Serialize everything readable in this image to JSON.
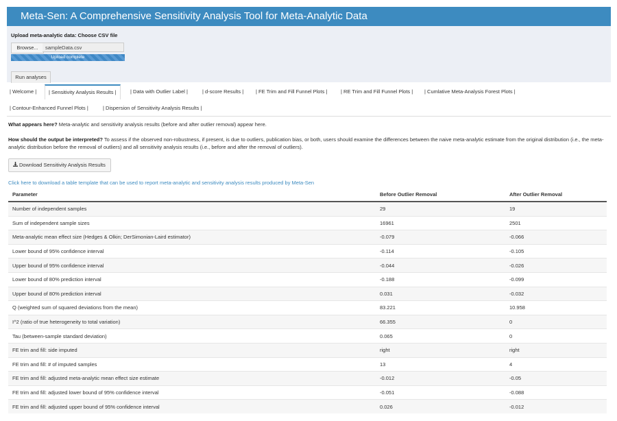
{
  "app": {
    "title": "Meta-Sen: A Comprehensive Sensitivity Analysis Tool for Meta-Analytic Data"
  },
  "upload": {
    "label": "Upload meta-analytic data: Choose CSV file",
    "browse_label": "Browse...",
    "file_name": "sampleData.csv",
    "progress_text": "Upload complete",
    "progress_percent": 100
  },
  "run_button": "Run analyses",
  "tabs": [
    "| Welcome |",
    "| Sensitivity Analysis Results |",
    "| Data with Outlier Label |",
    "| d-score Results |",
    "| FE Trim and Fill Funnel Plots |",
    "| RE Trim and Fill Funnel Plots |",
    "| Cumlative Meta-Analysis Forest Plots |",
    "| Contour-Enhanced Funnel Plots |",
    "| Dispersion of Sensitivity Analysis Results |"
  ],
  "active_tab": 1,
  "info": {
    "q1": "What appears here?",
    "a1": "Meta-analytic and sensitivity analysis results (before and after outlier removal) appear here.",
    "q2": "How should the output be interpreted?",
    "a2": "To assess if the observed non-robustness, if present, is due to outliers, publication bias, or both, users should examine the differences between the naive meta-analytic estimate from the original distribution (i.e., the meta-analytic distribution before the removal of outliers) and all sensitivity analysis results (i.e., before and after the removal of outliers)."
  },
  "download_button": "Download Sensitivity Analysis Results",
  "template_link": "Click here to download a table template that can be used to report meta-analytic and sensitivity analysis results produced by Meta-Sen",
  "table": {
    "headers": [
      "Parameter",
      "Before Outlier Removal",
      "After Outlier Removal"
    ],
    "rows": [
      [
        "Number of independent samples",
        "29",
        "19"
      ],
      [
        "Sum of independent sample sizes",
        "16961",
        "2501"
      ],
      [
        "Meta-analytic mean effect size (Hedges & Olkin; DerSimonian-Laird estimator)",
        "-0.079",
        "-0.066"
      ],
      [
        "Lower bound of 95% confidence interval",
        "-0.114",
        "-0.105"
      ],
      [
        "Upper bound of 95% confidence interval",
        "-0.044",
        "-0.026"
      ],
      [
        "Lower bound of 80% prediction interval",
        "-0.188",
        "-0.099"
      ],
      [
        "Upper bound of 80% prediction interval",
        "0.031",
        "-0.032"
      ],
      [
        "Q (weighted sum of squared deviations from the mean)",
        "83.221",
        "10.958"
      ],
      [
        "I^2 (ratio of true heterogeneity to total variation)",
        "66.355",
        "0"
      ],
      [
        "Tau (between-sample standard deviation)",
        "0.065",
        "0"
      ],
      [
        "FE trim and fill: side imputed",
        "right",
        "right"
      ],
      [
        "FE trim and fill: # of imputed samples",
        "13",
        "4"
      ],
      [
        "FE trim and fill: adjusted meta-analytic mean effect size estimate",
        "-0.012",
        "-0.05"
      ],
      [
        "FE trim and fill: adjusted lower bound of 95% confidence interval",
        "-0.051",
        "-0.088"
      ],
      [
        "FE trim and fill: adjusted upper bound of 95% confidence interval",
        "0.026",
        "-0.012"
      ]
    ]
  }
}
